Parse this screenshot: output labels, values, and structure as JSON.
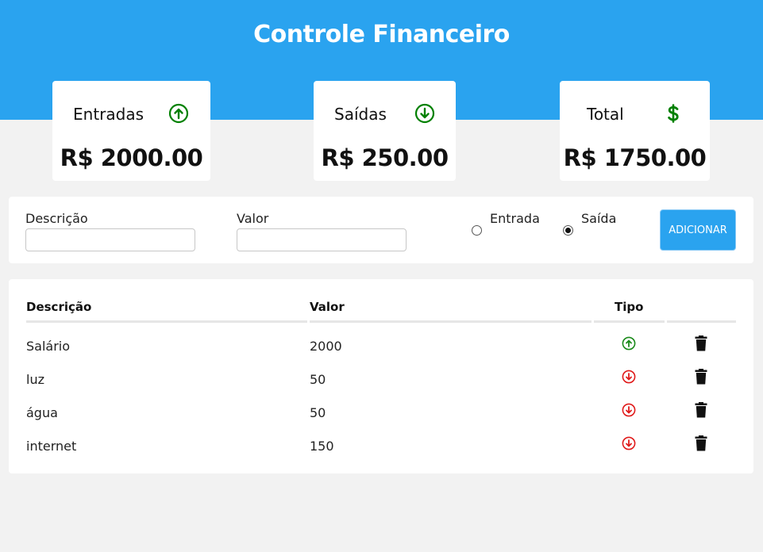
{
  "header": {
    "title": "Controle Financeiro",
    "bg_color": "#2aa3ef"
  },
  "summary": {
    "entradas": {
      "label": "Entradas",
      "value": "R$ 2000.00",
      "icon": "arrow-up-circle-icon",
      "icon_color": "#008000"
    },
    "saidas": {
      "label": "Saídas",
      "value": "R$ 250.00",
      "icon": "arrow-down-circle-icon",
      "icon_color": "#008000"
    },
    "total": {
      "label": "Total",
      "value": "R$ 1750.00",
      "icon": "dollar-icon",
      "icon_color": "#008000"
    }
  },
  "form": {
    "descricao_label": "Descrição",
    "descricao_value": "",
    "valor_label": "Valor",
    "valor_value": "",
    "radio_entrada_label": "Entrada",
    "radio_saida_label": "Saída",
    "selected_type": "Saída",
    "add_button_label": "ADICIONAR"
  },
  "table": {
    "headers": {
      "descricao": "Descrição",
      "valor": "Valor",
      "tipo": "Tipo"
    },
    "rows": [
      {
        "descricao": "Salário",
        "valor": "2000",
        "tipo": "entrada",
        "icon": "arrow-up-circle-icon"
      },
      {
        "descricao": "luz",
        "valor": "50",
        "tipo": "saida",
        "icon": "arrow-down-circle-icon"
      },
      {
        "descricao": "água",
        "valor": "50",
        "tipo": "saida",
        "icon": "arrow-down-circle-icon"
      },
      {
        "descricao": "internet",
        "valor": "150",
        "tipo": "saida",
        "icon": "arrow-down-circle-icon"
      }
    ],
    "delete_icon": "trash-icon",
    "income_color": "#1a8a1a",
    "expense_color": "#e01b1b"
  }
}
